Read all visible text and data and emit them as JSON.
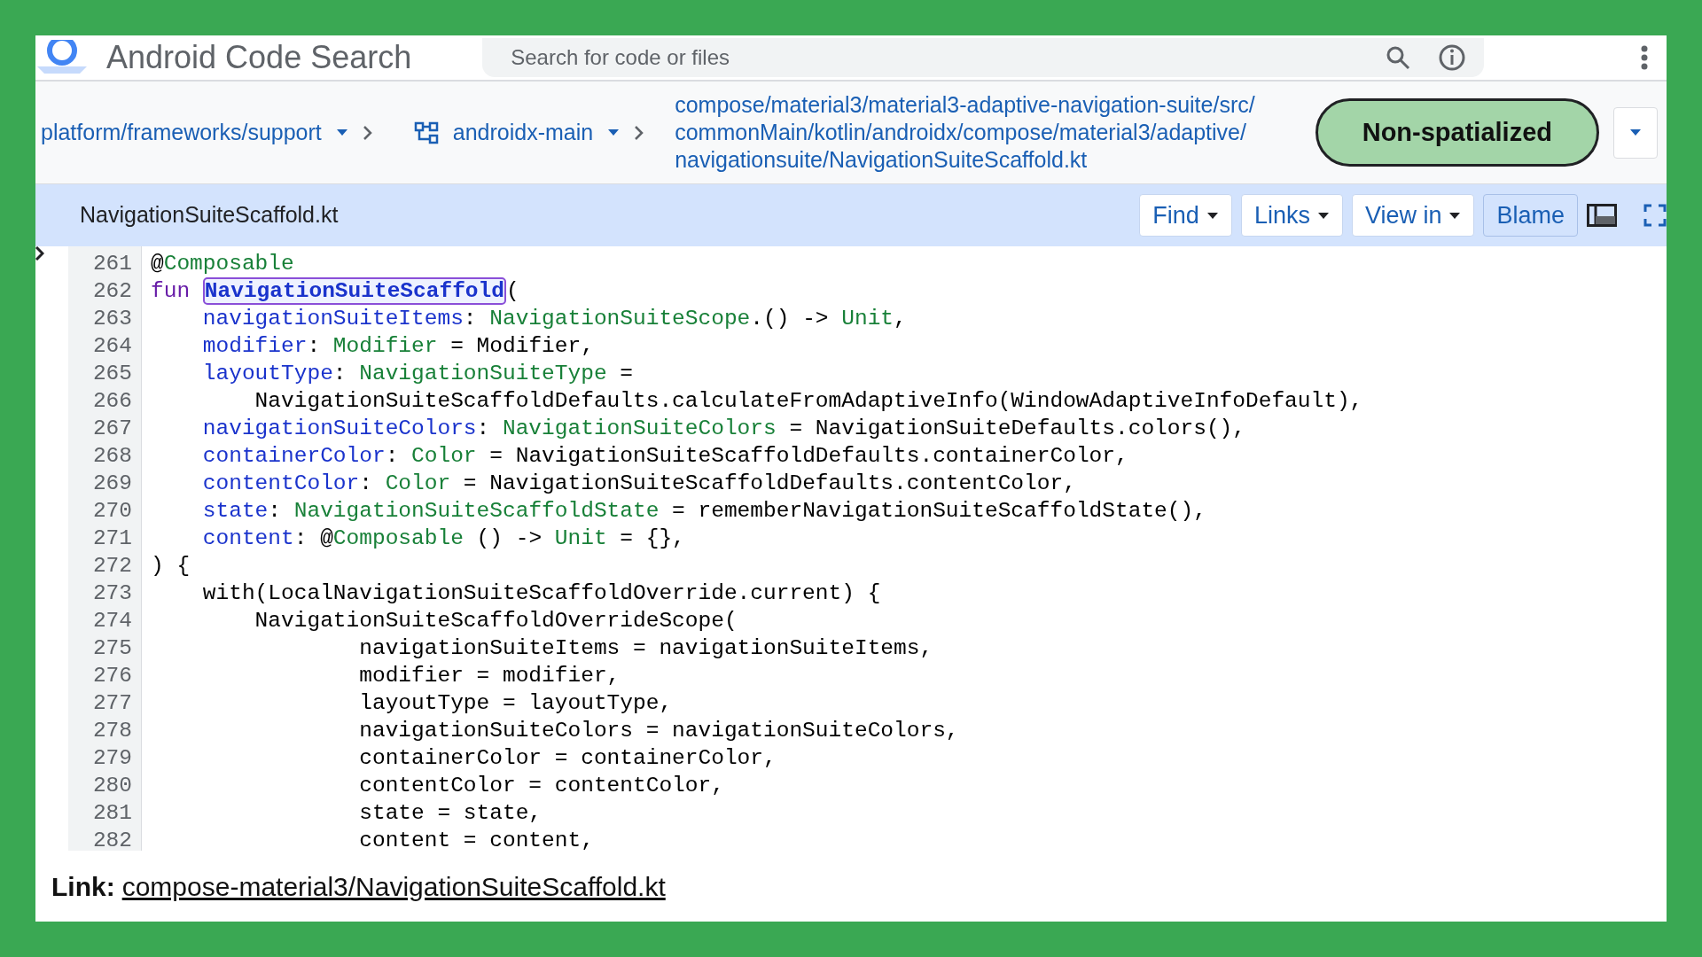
{
  "header": {
    "title": "Android Code Search",
    "search": {
      "placeholder": "Search for code or files"
    }
  },
  "breadcrumb": {
    "repo": "platform/frameworks/support",
    "branch": "androidx-main",
    "path": [
      "compose/material3/material3-adaptive-navigation-suite/src/",
      "commonMain/kotlin/androidx/compose/material3/adaptive/",
      "navigationsuite/NavigationSuiteScaffold.kt"
    ],
    "badge": "Non-spatialized"
  },
  "file_bar": {
    "filename": "NavigationSuiteScaffold.kt",
    "buttons": [
      {
        "label": "Find",
        "dropdown": true
      },
      {
        "label": "Links",
        "dropdown": true
      },
      {
        "label": "View in",
        "dropdown": true
      },
      {
        "label": "Blame",
        "dropdown": false
      }
    ]
  },
  "code": [
    {
      "number": "261",
      "segments": [
        {
          "kind": "plain",
          "text": "@"
        },
        {
          "kind": "type",
          "text": "Composable"
        }
      ]
    },
    {
      "number": "262",
      "segments": [
        {
          "kind": "keyword",
          "text": "fun "
        },
        {
          "kind": "highlight",
          "text": "NavigationSuiteScaffold"
        },
        {
          "kind": "plain",
          "text": "("
        }
      ]
    },
    {
      "number": "263",
      "segments": [
        {
          "kind": "param",
          "text": "    navigationSuiteItems"
        },
        {
          "kind": "plain",
          "text": ": "
        },
        {
          "kind": "type",
          "text": "NavigationSuiteScope"
        },
        {
          "kind": "plain",
          "text": ".() -> "
        },
        {
          "kind": "type",
          "text": "Unit"
        },
        {
          "kind": "plain",
          "text": ","
        }
      ]
    },
    {
      "number": "264",
      "segments": [
        {
          "kind": "param",
          "text": "    modifier"
        },
        {
          "kind": "plain",
          "text": ": "
        },
        {
          "kind": "type",
          "text": "Modifier"
        },
        {
          "kind": "plain",
          "text": " = Modifier,"
        }
      ]
    },
    {
      "number": "265",
      "segments": [
        {
          "kind": "param",
          "text": "    layoutType"
        },
        {
          "kind": "plain",
          "text": ": "
        },
        {
          "kind": "type",
          "text": "NavigationSuiteType"
        },
        {
          "kind": "plain",
          "text": " ="
        }
      ]
    },
    {
      "number": "266",
      "segments": [
        {
          "kind": "plain",
          "text": "        NavigationSuiteScaffoldDefaults.calculateFromAdaptiveInfo(WindowAdaptiveInfoDefault),"
        }
      ]
    },
    {
      "number": "267",
      "segments": [
        {
          "kind": "param",
          "text": "    navigationSuiteColors"
        },
        {
          "kind": "plain",
          "text": ": "
        },
        {
          "kind": "type",
          "text": "NavigationSuiteColors"
        },
        {
          "kind": "plain",
          "text": " = NavigationSuiteDefaults.colors(),"
        }
      ]
    },
    {
      "number": "268",
      "segments": [
        {
          "kind": "param",
          "text": "    containerColor"
        },
        {
          "kind": "plain",
          "text": ": "
        },
        {
          "kind": "type",
          "text": "Color"
        },
        {
          "kind": "plain",
          "text": " = NavigationSuiteScaffoldDefaults.containerColor,"
        }
      ]
    },
    {
      "number": "269",
      "segments": [
        {
          "kind": "param",
          "text": "    contentColor"
        },
        {
          "kind": "plain",
          "text": ": "
        },
        {
          "kind": "type",
          "text": "Color"
        },
        {
          "kind": "plain",
          "text": " = NavigationSuiteScaffoldDefaults.contentColor,"
        }
      ]
    },
    {
      "number": "270",
      "segments": [
        {
          "kind": "param",
          "text": "    state"
        },
        {
          "kind": "plain",
          "text": ": "
        },
        {
          "kind": "type",
          "text": "NavigationSuiteScaffoldState"
        },
        {
          "kind": "plain",
          "text": " = rememberNavigationSuiteScaffoldState(),"
        }
      ]
    },
    {
      "number": "271",
      "segments": [
        {
          "kind": "param",
          "text": "    content"
        },
        {
          "kind": "plain",
          "text": ": @"
        },
        {
          "kind": "type",
          "text": "Composable"
        },
        {
          "kind": "plain",
          "text": " () -> "
        },
        {
          "kind": "type",
          "text": "Unit"
        },
        {
          "kind": "plain",
          "text": " = {},"
        }
      ]
    },
    {
      "number": "272",
      "segments": [
        {
          "kind": "plain",
          "text": ") {"
        }
      ]
    },
    {
      "number": "273",
      "segments": [
        {
          "kind": "plain",
          "text": "    with(LocalNavigationSuiteScaffoldOverride.current) {"
        }
      ]
    },
    {
      "number": "274",
      "segments": [
        {
          "kind": "plain",
          "text": "        NavigationSuiteScaffoldOverrideScope("
        }
      ]
    },
    {
      "number": "275",
      "segments": [
        {
          "kind": "plain",
          "text": "                navigationSuiteItems = navigationSuiteItems,"
        }
      ]
    },
    {
      "number": "276",
      "segments": [
        {
          "kind": "plain",
          "text": "                modifier = modifier,"
        }
      ]
    },
    {
      "number": "277",
      "segments": [
        {
          "kind": "plain",
          "text": "                layoutType = layoutType,"
        }
      ]
    },
    {
      "number": "278",
      "segments": [
        {
          "kind": "plain",
          "text": "                navigationSuiteColors = navigationSuiteColors,"
        }
      ]
    },
    {
      "number": "279",
      "segments": [
        {
          "kind": "plain",
          "text": "                containerColor = containerColor,"
        }
      ]
    },
    {
      "number": "280",
      "segments": [
        {
          "kind": "plain",
          "text": "                contentColor = contentColor,"
        }
      ]
    },
    {
      "number": "281",
      "segments": [
        {
          "kind": "plain",
          "text": "                state = state,"
        }
      ]
    },
    {
      "number": "282",
      "segments": [
        {
          "kind": "plain",
          "text": "                content = content,"
        }
      ]
    }
  ],
  "caption": {
    "label": "Link:",
    "link": "compose-material3/NavigationSuiteScaffold.kt"
  }
}
